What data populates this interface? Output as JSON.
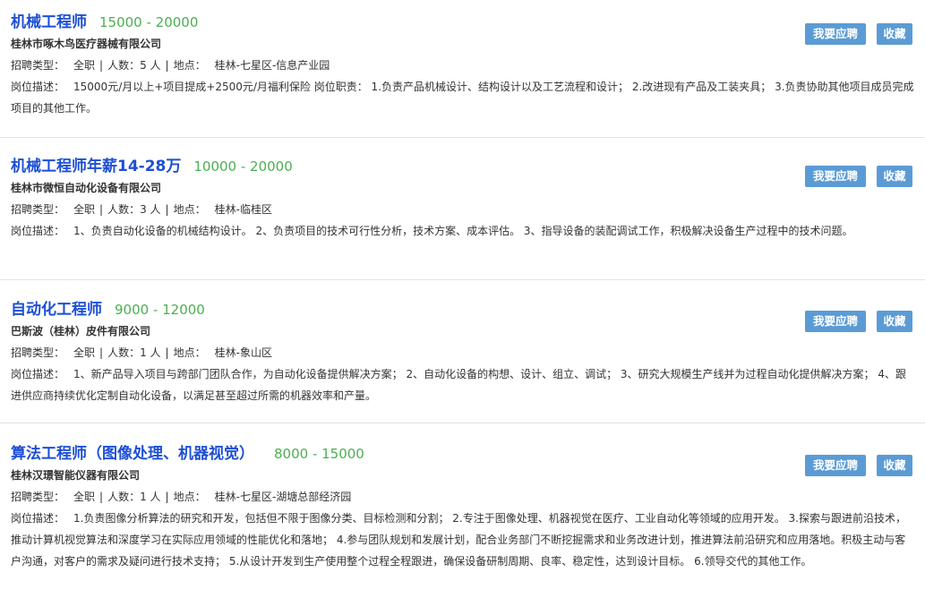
{
  "labels": {
    "type": "招聘类型：",
    "count": "人数：",
    "location": "地点：",
    "desc": "岗位描述：",
    "apply": "我要应聘",
    "favorite": "收藏",
    "divider": "|"
  },
  "jobs": [
    {
      "title": "机械工程师",
      "salary": "15000 - 20000",
      "company": "桂林市啄木鸟医疗器械有限公司",
      "type": "全职",
      "count": "5 人",
      "location": "桂林-七星区-信息产业园",
      "desc": "15000元/月以上+项目提成+2500元/月福利保险 岗位职责： 1.负责产品机械设计、结构设计以及工艺流程和设计； 2.改进现有产品及工装夹具； 3.负责协助其他项目成员完成项目的其他工作。"
    },
    {
      "title": "机械工程师年薪14-28万",
      "salary": "10000 - 20000",
      "company": "桂林市微恒自动化设备有限公司",
      "type": "全职",
      "count": "3 人",
      "location": "桂林-临桂区",
      "desc": "1、负责自动化设备的机械结构设计。 2、负责项目的技术可行性分析，技术方案、成本评估。 3、指导设备的装配调试工作，积极解决设备生产过程中的技术问题。"
    },
    {
      "title": "自动化工程师",
      "salary": "9000 - 12000",
      "company": "巴斯波（桂林）皮件有限公司",
      "type": "全职",
      "count": "1 人",
      "location": "桂林-象山区",
      "desc": "1、新产品导入项目与跨部门团队合作，为自动化设备提供解决方案； 2、自动化设备的构想、设计、组立、调试； 3、研究大规模生产线并为过程自动化提供解决方案； 4、跟进供应商持续优化定制自动化设备，以满足甚至超过所需的机器效率和产量。"
    },
    {
      "title": "算法工程师（图像处理、机器视觉）",
      "salary": "8000 - 15000",
      "company": "桂林汉璟智能仪器有限公司",
      "type": "全职",
      "count": "1 人",
      "location": "桂林-七星区-湖塘总部经济园",
      "desc": "1.负责图像分析算法的研究和开发，包括但不限于图像分类、目标检测和分割； 2.专注于图像处理、机器视觉在医疗、工业自动化等领域的应用开发。 3.探索与跟进前沿技术，推动计算机视觉算法和深度学习在实际应用领域的性能优化和落地； 4.参与团队规划和发展计划，配合业务部门不断挖掘需求和业务改进计划，推进算法前沿研究和应用落地。积极主动与客户沟通，对客户的需求及疑问进行技术支持； 5.从设计开发到生产使用整个过程全程跟进，确保设备研制周期、良率、稳定性，达到设计目标。 6.领导交代的其他工作。"
    }
  ]
}
